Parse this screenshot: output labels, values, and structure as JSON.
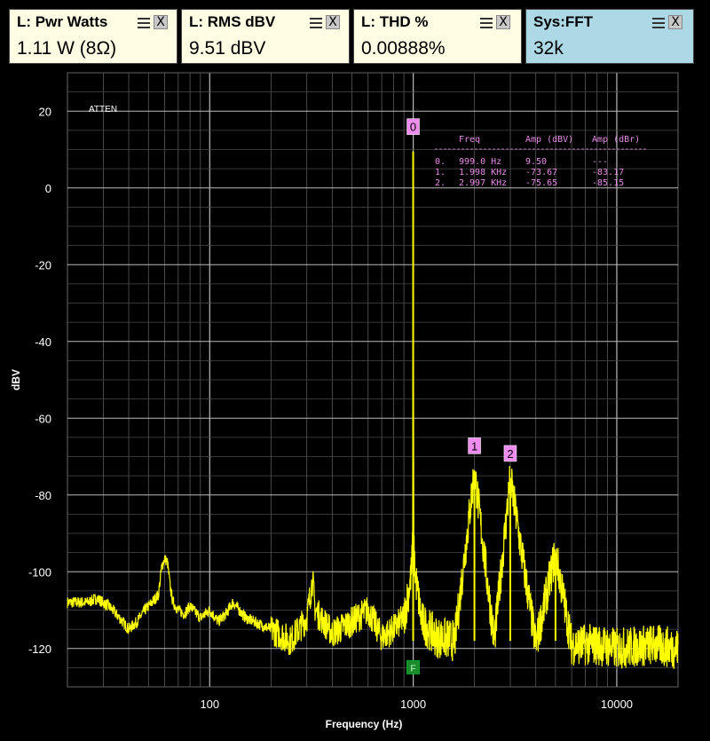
{
  "meters": [
    {
      "id": "pwr",
      "title": "L: Pwr Watts",
      "value": "1.11 W (8Ω)",
      "close": "X"
    },
    {
      "id": "rms",
      "title": "L: RMS dBV",
      "value": "9.51 dBV",
      "close": "X"
    },
    {
      "id": "thd",
      "title": "L: THD %",
      "value": "0.00888%",
      "close": "X"
    },
    {
      "id": "fft",
      "title": "Sys:FFT",
      "value": "32k",
      "close": "X"
    }
  ],
  "chart_data": {
    "type": "line",
    "xscale": "log",
    "xlabel": "Frequency (Hz)",
    "ylabel": "dBV",
    "xlim": [
      20,
      20000
    ],
    "ylim": [
      -130,
      30
    ],
    "xticks": [
      100,
      1000,
      10000
    ],
    "xtick_labels": [
      "100",
      "1000",
      "10000"
    ],
    "yticks": [
      20,
      0,
      -20,
      -40,
      -60,
      -80,
      -100,
      -120
    ],
    "ytick_labels": [
      "20",
      "0",
      "-20",
      "-40",
      "-60",
      "-80",
      "-100",
      "-120"
    ],
    "grid": true,
    "annotation": "ATTEN",
    "line_color": "#ffff00",
    "noise_points": [
      [
        20,
        -108
      ],
      [
        25,
        -108
      ],
      [
        28,
        -107
      ],
      [
        32,
        -109
      ],
      [
        36,
        -112
      ],
      [
        40,
        -115
      ],
      [
        44,
        -113
      ],
      [
        48,
        -110
      ],
      [
        52,
        -108
      ],
      [
        56,
        -106
      ],
      [
        58,
        -99
      ],
      [
        60,
        -96.5
      ],
      [
        62,
        -97.5
      ],
      [
        64,
        -104
      ],
      [
        66,
        -108
      ],
      [
        70,
        -110
      ],
      [
        75,
        -111
      ],
      [
        80,
        -109
      ],
      [
        90,
        -112
      ],
      [
        100,
        -110
      ],
      [
        110,
        -113
      ],
      [
        120,
        -111
      ],
      [
        130,
        -108
      ],
      [
        150,
        -112
      ],
      [
        200,
        -115
      ],
      [
        250,
        -118
      ],
      [
        300,
        -112
      ],
      [
        320,
        -102
      ],
      [
        330,
        -110
      ],
      [
        400,
        -116
      ],
      [
        500,
        -113
      ],
      [
        600,
        -110
      ],
      [
        700,
        -117
      ],
      [
        800,
        -115
      ],
      [
        900,
        -112
      ],
      [
        950,
        -105
      ],
      [
        980,
        -100
      ],
      [
        990,
        -95
      ],
      [
        995,
        -88
      ],
      [
        999,
        9.5
      ],
      [
        1005,
        -88
      ],
      [
        1010,
        -96
      ],
      [
        1030,
        -102
      ],
      [
        1100,
        -113
      ],
      [
        1300,
        -117
      ],
      [
        1600,
        -118
      ],
      [
        1998,
        -73.67
      ],
      [
        2500,
        -118
      ],
      [
        2997,
        -75.65
      ],
      [
        4000,
        -119
      ],
      [
        5000,
        -95
      ],
      [
        6000,
        -119
      ],
      [
        8000,
        -119
      ],
      [
        10000,
        -120
      ],
      [
        15000,
        -119
      ],
      [
        20000,
        -120
      ]
    ],
    "peaks": [
      {
        "label": "0",
        "freq": 999.0,
        "amp": 9.5
      },
      {
        "label": "1",
        "freq": 1998,
        "amp": -73.67
      },
      {
        "label": "2",
        "freq": 2997,
        "amp": -75.65
      }
    ],
    "extra_spur": {
      "freq": 5000,
      "amp": -95
    },
    "fundamental_marker": {
      "label": "F",
      "freq": 999.0,
      "amp": -125
    },
    "table": {
      "headers": [
        "Freq",
        "Amp (dBV)",
        "Amp (dBr)"
      ],
      "rows": [
        {
          "idx": "0.",
          "freq": "999.0 Hz",
          "dbv": "9.50",
          "dbr": "---"
        },
        {
          "idx": "1.",
          "freq": "1.998 KHz",
          "dbv": "-73.67",
          "dbr": "-83.17"
        },
        {
          "idx": "2.",
          "freq": "2.997 KHz",
          "dbv": "-75.65",
          "dbr": "-85.15"
        }
      ]
    }
  }
}
